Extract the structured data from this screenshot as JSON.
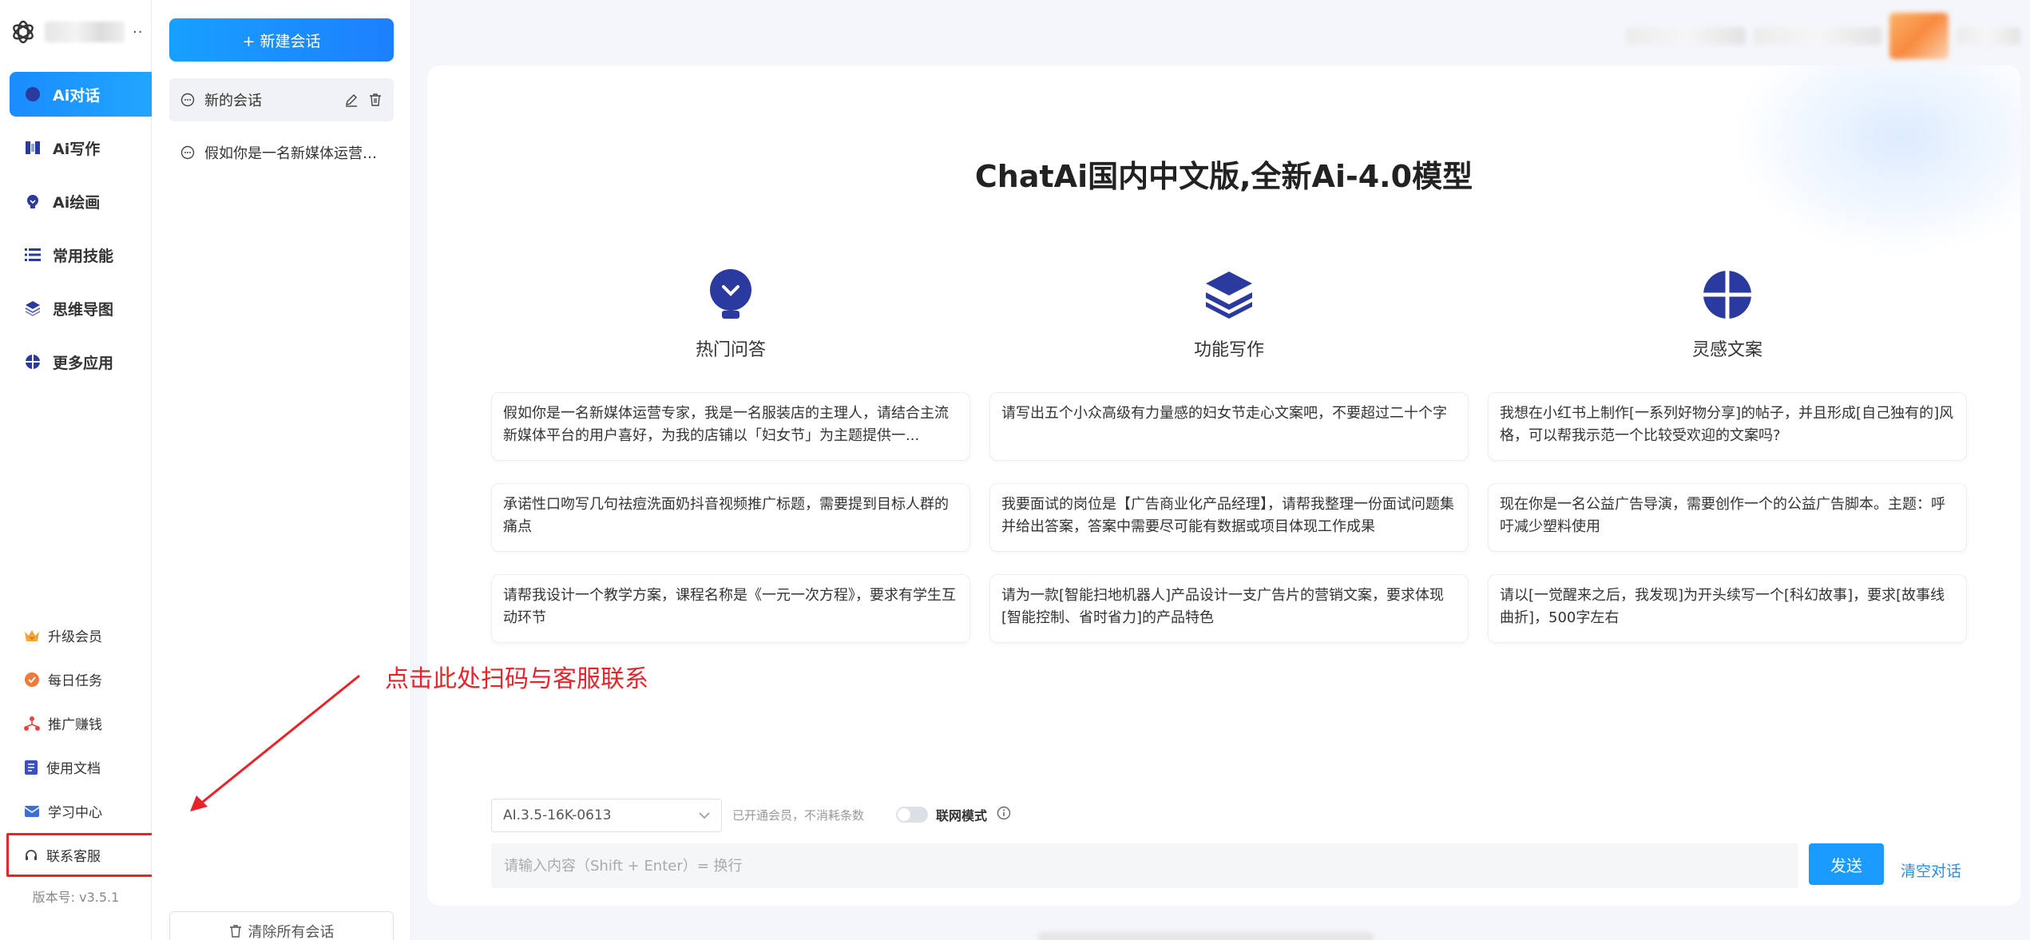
{
  "nav": {
    "items": [
      {
        "label": "Ai对话",
        "icon": "chat-bubble-icon",
        "active": true
      },
      {
        "label": "Ai写作",
        "icon": "book-icon",
        "active": false
      },
      {
        "label": "Ai绘画",
        "icon": "lightbulb-icon",
        "active": false
      },
      {
        "label": "常用技能",
        "icon": "list-icon",
        "active": false
      },
      {
        "label": "思维导图",
        "icon": "layers-icon",
        "active": false
      },
      {
        "label": "更多应用",
        "icon": "grid-circle-icon",
        "active": false
      }
    ],
    "bottom": [
      {
        "label": "升级会员",
        "icon": "crown-icon"
      },
      {
        "label": "每日任务",
        "icon": "task-badge-icon"
      },
      {
        "label": "推广赚钱",
        "icon": "network-icon"
      },
      {
        "label": "使用文档",
        "icon": "document-icon"
      },
      {
        "label": "学习中心",
        "icon": "mail-icon"
      },
      {
        "label": "联系客服",
        "icon": "headset-icon",
        "highlighted": true
      }
    ],
    "version": "版本号: v3.5.1"
  },
  "sessions": {
    "new_label": "+ 新建会话",
    "items": [
      {
        "title": "新的会话",
        "active": true
      },
      {
        "title": "假如你是一名新媒体运营专家，我是一名服装店的主理人",
        "active": false
      }
    ],
    "clear_all": "清除所有会话"
  },
  "main": {
    "title": "ChatAi国内中文版,全新Ai-4.0模型",
    "columns": [
      {
        "heading": "热门问答",
        "icon": "lightbulb-icon",
        "cards": [
          "假如你是一名新媒体运营专家，我是一名服装店的主理人，请结合主流新媒体平台的用户喜好，为我的店铺以「妇女节」为主题提供一...",
          "承诺性口吻写几句祛痘洗面奶抖音视频推广标题，需要提到目标人群的痛点",
          "请帮我设计一个教学方案，课程名称是《一元一次方程》，要求有学生互动环节"
        ]
      },
      {
        "heading": "功能写作",
        "icon": "layers-icon",
        "cards": [
          "请写出五个小众高级有力量感的妇女节走心文案吧，不要超过二十个字",
          "我要面试的岗位是【广告商业化产品经理】，请帮我整理一份面试问题集并给出答案，答案中需要尽可能有数据或项目体现工作成果",
          "请为一款[智能扫地机器人]产品设计一支广告片的营销文案，要求体现[智能控制、省时省力]的产品特色"
        ]
      },
      {
        "heading": "灵感文案",
        "icon": "globe-icon",
        "cards": [
          "我想在小红书上制作[一系列好物分享]的帖子，并且形成[自己独有的]风格，可以帮我示范一个比较受欢迎的文案吗?",
          "现在你是一名公益广告导演，需要创作一个的公益广告脚本。主题：呼吁减少塑料使用",
          "请以[一觉醒来之后，我发现]为开头续写一个[科幻故事]，要求[故事线曲折]，500字左右"
        ]
      }
    ]
  },
  "input": {
    "model": "AI.3.5-16K-0613",
    "member_note": "已开通会员，不消耗条数",
    "net_mode_label": "联网模式",
    "net_mode_on": false,
    "placeholder": "请输入内容（Shift + Enter）= 换行",
    "value": "",
    "send_label": "发送",
    "clear_label": "清空对话"
  },
  "annotation": {
    "text": "点击此处扫码与客服联系"
  },
  "colors": {
    "accent": "#1a9bff",
    "icon_indigo": "#2b3a9e",
    "annotation_red": "#e8242a"
  }
}
